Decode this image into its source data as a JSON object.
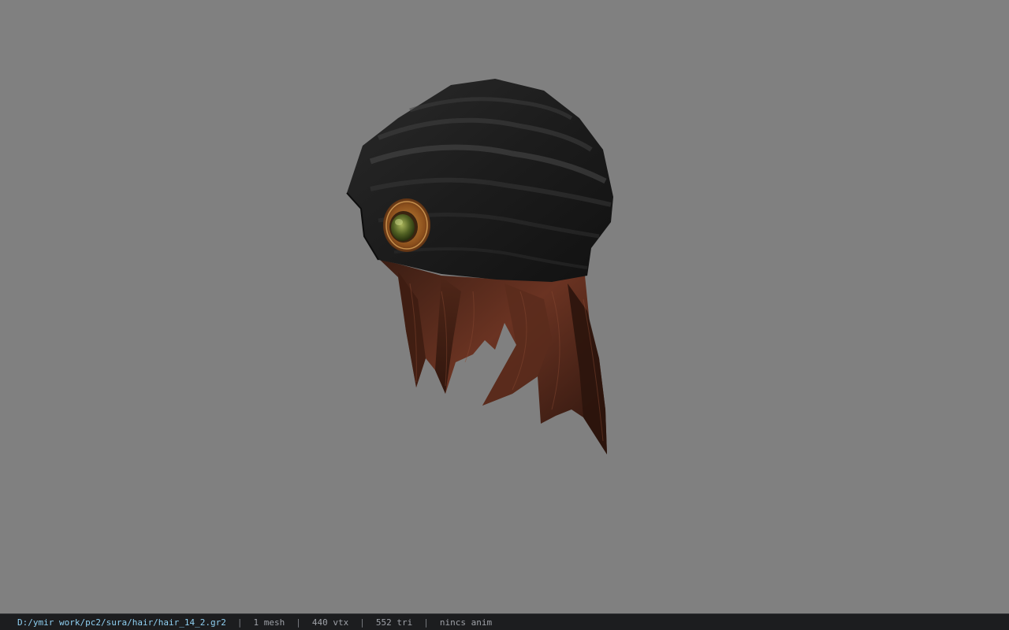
{
  "viewport": {
    "background_color": "#808080",
    "model": {
      "asset": "hair_14_2.gr2",
      "parts": [
        "black-turban",
        "green-gem-brooch",
        "brown-hair"
      ]
    }
  },
  "statusbar": {
    "file_path": "D:/ymir work/pc2/sura/hair/hair_14_2.gr2",
    "separator": "|",
    "mesh_count": "1 mesh",
    "vertex_count": "440 vtx",
    "triangle_count": "552 tri",
    "animation": "nincs anim"
  }
}
